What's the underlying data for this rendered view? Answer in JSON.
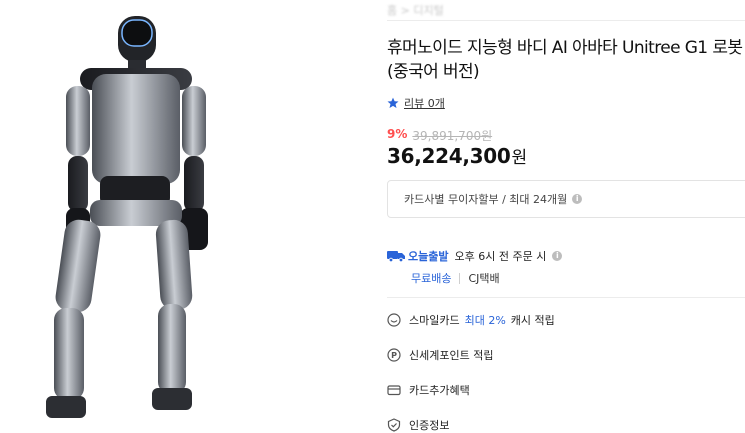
{
  "breadcrumb": "홈 > 디지털",
  "product": {
    "title": "휴머노이드 지능형 바디 AI 아바타 Unitree G1 로봇 (중국어 버전)"
  },
  "review": {
    "label": "리뷰 0개"
  },
  "price": {
    "discount": "9%",
    "original": "39,891,700원",
    "sale_amount": "36,224,300",
    "currency": "원"
  },
  "card_installment": "카드사별 무이자할부 / 최대 24개월",
  "shipping": {
    "badge": "오늘출발",
    "cutoff": "오후 6시 전 주문 시",
    "free": "무료배송",
    "courier": "CJ택배"
  },
  "benefits": [
    {
      "icon": "smile-card-icon",
      "prefix": "스마일카드",
      "highlight": "최대 2%",
      "suffix": "캐시 적립"
    },
    {
      "icon": "point-icon",
      "label": "신세계포인트 적립"
    },
    {
      "icon": "card-icon",
      "label": "카드추가혜택"
    },
    {
      "icon": "certification-icon",
      "label": "인증정보"
    }
  ],
  "colors": {
    "accent": "#2a64d8",
    "discount": "#ff4f4f"
  }
}
